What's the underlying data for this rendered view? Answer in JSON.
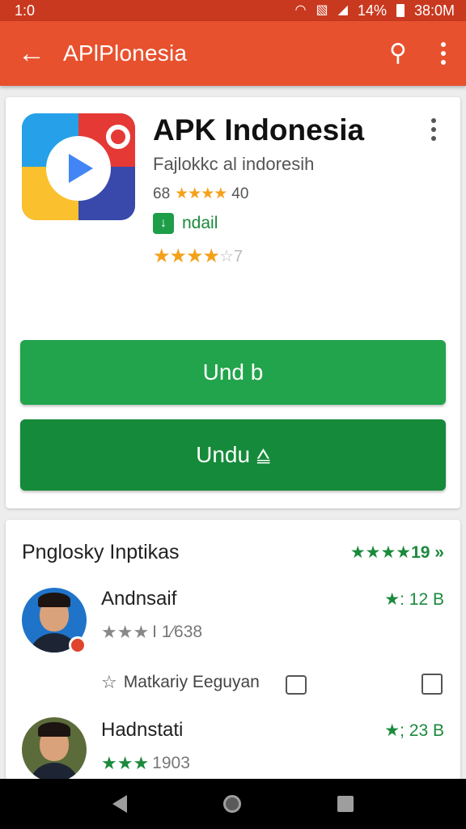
{
  "status_bar": {
    "time": "1:0",
    "battery": "14%",
    "clock_right": "38:0M",
    "icons": [
      "wifi-icon",
      "no-sim-icon",
      "signal-icon",
      "battery-icon"
    ]
  },
  "toolbar": {
    "title": "APlPlonesia",
    "icons": [
      "back-arrow-icon",
      "search-icon",
      "more-vert-icon"
    ]
  },
  "app": {
    "name": "APK Indonesia",
    "subtitle": "Fajlokkc al indoresih",
    "rating_prefix": "68",
    "rating_stars": "★★★★",
    "rating_suffix": "40",
    "download_label": "ndail",
    "stars_filled": "★★★★",
    "stars_partial": "☆7",
    "icon": "app-logo-icon"
  },
  "buttons": {
    "primary": "Und b",
    "secondary": "Undu ⩠"
  },
  "reviews": {
    "heading": "Pnglosky Inptikas",
    "overall": "★★★★19 »",
    "items": [
      {
        "name": "Andnsaif",
        "stars": "★★★",
        "meta": "I 1⁄638",
        "score": "★: 12 B",
        "helpful_label": "Matkariy Eeguyan"
      },
      {
        "name": "Hadnstati",
        "stars": "★★★",
        "meta": "1903",
        "score": "★; 23 B"
      }
    ]
  },
  "colors": {
    "status_bar": "#c9391f",
    "toolbar": "#e8512e",
    "accent_green": "#22a44c",
    "dark_green": "#158a3a",
    "star_gold": "#f4a11a"
  }
}
